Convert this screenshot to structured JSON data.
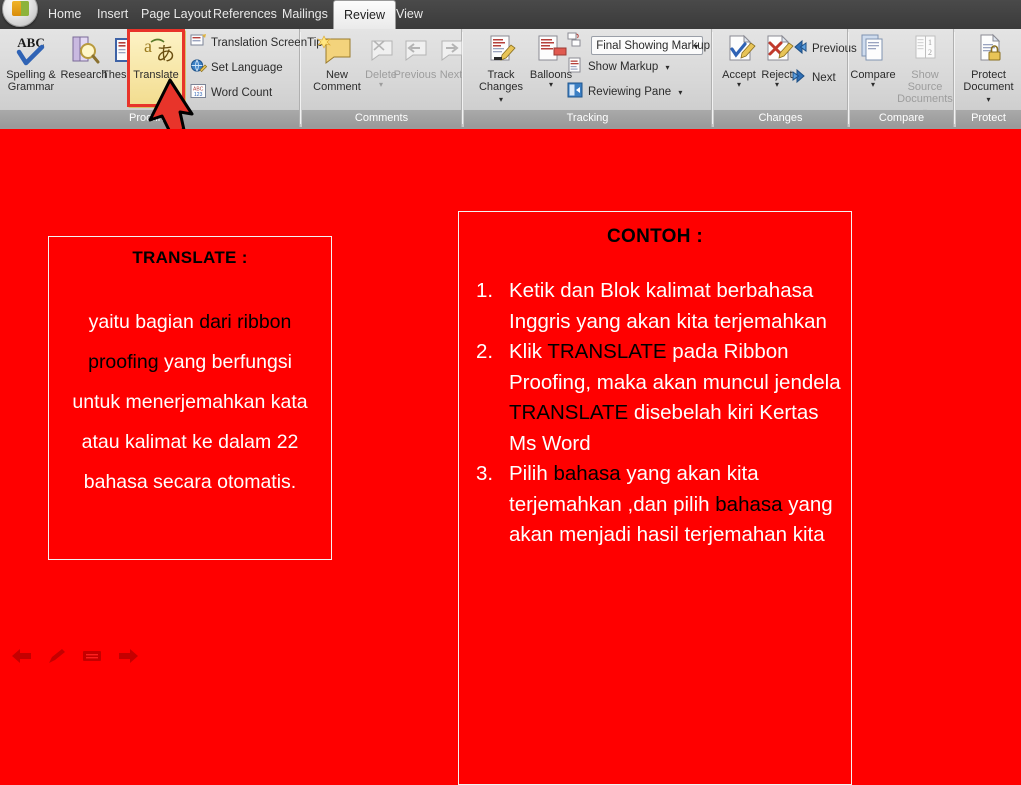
{
  "app": {
    "office_button": "office-logo-button"
  },
  "ribbon": {
    "tabs": [
      {
        "label": "Home",
        "active": false
      },
      {
        "label": "Insert",
        "active": false
      },
      {
        "label": "Page Layout",
        "active": false
      },
      {
        "label": "References",
        "active": false
      },
      {
        "label": "Mailings",
        "active": false
      },
      {
        "label": "Review",
        "active": true
      },
      {
        "label": "View",
        "active": false
      }
    ],
    "groups": [
      {
        "name": "Proofing",
        "label": "Proofing",
        "big_buttons": [
          {
            "label": "Spelling &\nGrammar",
            "icon": "abc-check-icon",
            "dim": false
          },
          {
            "label": "Research",
            "icon": "book-magnifier-icon",
            "dim": false
          },
          {
            "label": "Thesaurus",
            "icon": "open-book-icon",
            "dim": false
          },
          {
            "label": "Translate",
            "icon": "translate-a-icon",
            "dim": false,
            "highlighted": true
          }
        ],
        "small_buttons": [
          {
            "label": "Translation ScreenTip",
            "icon": "screentip-icon",
            "caret": true,
            "dim": false
          },
          {
            "label": "Set Language",
            "icon": "globe-pencil-icon",
            "caret": false,
            "dim": false
          },
          {
            "label": "Word Count",
            "icon": "abc123-icon",
            "caret": false,
            "dim": false
          }
        ]
      },
      {
        "name": "Comments",
        "label": "Comments",
        "big_buttons": [
          {
            "label": "New\nComment",
            "icon": "new-comment-icon",
            "dim": false
          },
          {
            "label": "Delete",
            "icon": "delete-comment-icon",
            "dim": true,
            "caret": true
          },
          {
            "label": "Previous",
            "icon": "previous-comment-icon",
            "dim": true
          },
          {
            "label": "Next",
            "icon": "next-comment-icon",
            "dim": true
          }
        ],
        "small_buttons": []
      },
      {
        "name": "Tracking",
        "label": "Tracking",
        "big_buttons": [
          {
            "label": "Track\nChanges",
            "icon": "track-changes-icon",
            "dim": false,
            "caret": true
          },
          {
            "label": "Balloons",
            "icon": "balloons-icon",
            "dim": false,
            "caret": true
          }
        ],
        "dropdown": {
          "value": "Final Showing Markup",
          "icon": "markup-display-icon"
        },
        "small_buttons": [
          {
            "label": "Show Markup",
            "icon": "show-markup-icon",
            "caret": true,
            "dim": false
          },
          {
            "label": "Reviewing Pane",
            "icon": "reviewing-pane-icon",
            "caret": true,
            "dim": false
          }
        ]
      },
      {
        "name": "Changes",
        "label": "Changes",
        "big_buttons": [
          {
            "label": "Accept",
            "icon": "accept-change-icon",
            "dim": false,
            "caret": true
          },
          {
            "label": "Reject",
            "icon": "reject-change-icon",
            "dim": false,
            "caret": true
          }
        ],
        "small_buttons": [
          {
            "label": "Previous",
            "icon": "previous-change-icon",
            "caret": false,
            "dim": false
          },
          {
            "label": "Next",
            "icon": "next-change-icon",
            "caret": false,
            "dim": false
          }
        ]
      },
      {
        "name": "Compare",
        "label": "Compare",
        "big_buttons": [
          {
            "label": "Compare",
            "icon": "compare-docs-icon",
            "dim": false,
            "caret": true
          },
          {
            "label": "Show Source\nDocuments",
            "icon": "source-documents-icon",
            "dim": true,
            "caret": true
          }
        ],
        "small_buttons": []
      },
      {
        "name": "Protect",
        "label": "Protect",
        "big_buttons": [
          {
            "label": "Protect\nDocument",
            "icon": "protect-document-icon",
            "dim": false,
            "caret": true
          }
        ],
        "small_buttons": []
      }
    ]
  },
  "slide": {
    "background_color": "#FF0000",
    "left_box": {
      "title": "TRANSLATE  :",
      "title_color": "#000000",
      "segments": [
        {
          "text": "yaitu bagian ",
          "color": "#FFFFFF"
        },
        {
          "text": "dari ribbon proofing ",
          "color": "#000000"
        },
        {
          "text": "yang berfungsi untuk menerjemahkan kata atau kalimat ke dalam 22 bahasa secara otomatis.",
          "color": "#FFFFFF"
        }
      ]
    },
    "right_box": {
      "title": "CONTOH :",
      "title_color": "#000000",
      "items": [
        {
          "num": "1.",
          "segments": [
            {
              "text": "Ketik dan Blok  kalimat berbahasa Inggris yang akan kita terjemahkan",
              "color": "#FFFFFF"
            }
          ]
        },
        {
          "num": "2.",
          "segments": [
            {
              "text": "Klik ",
              "color": "#FFFFFF"
            },
            {
              "text": "TRANSLATE",
              "color": "#000000"
            },
            {
              "text": " pada Ribbon Proofing, maka akan muncul jendela ",
              "color": "#FFFFFF"
            },
            {
              "text": "TRANSLATE",
              "color": "#000000"
            },
            {
              "text": " disebelah kiri Kertas Ms Word",
              "color": "#FFFFFF"
            }
          ]
        },
        {
          "num": "3.",
          "segments": [
            {
              "text": "Pilih ",
              "color": "#FFFFFF"
            },
            {
              "text": "bahasa",
              "color": "#000000"
            },
            {
              "text": " yang akan kita terjemahkan ,dan pilih ",
              "color": "#FFFFFF"
            },
            {
              "text": "bahasa",
              "color": "#000000"
            },
            {
              "text": " yang akan menjadi hasil terjemahan kita",
              "color": "#FFFFFF"
            }
          ]
        }
      ]
    }
  },
  "annotation": {
    "highlight_color": "#E8342A",
    "arrow_color": "#E8342A",
    "arrow_target": "translate-button"
  },
  "slideshow_nav": {
    "buttons": [
      {
        "name": "previous-slide-icon"
      },
      {
        "name": "pen-icon"
      },
      {
        "name": "slide-menu-icon"
      },
      {
        "name": "next-slide-icon"
      }
    ]
  }
}
